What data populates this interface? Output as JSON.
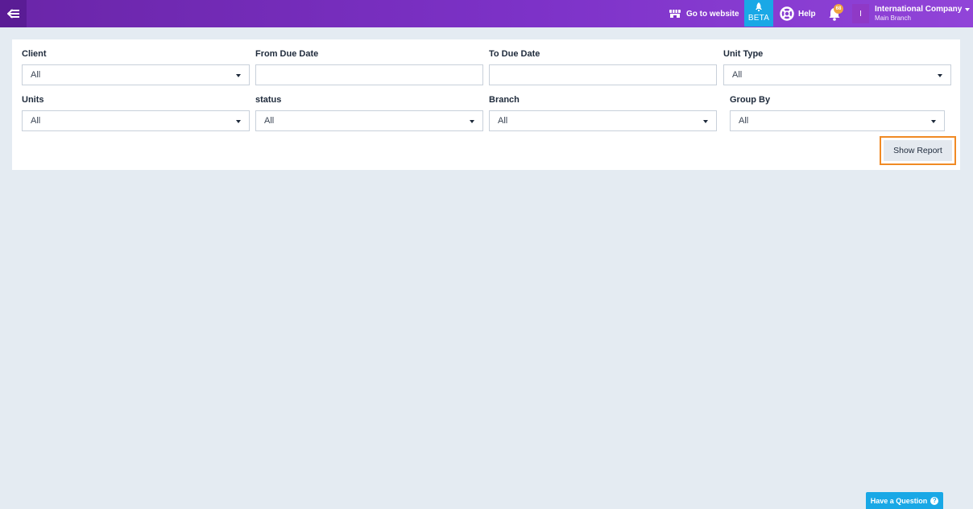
{
  "topbar": {
    "website_label": "Go to website",
    "beta_label": "BETA",
    "help_label": "Help",
    "notification_count": "68",
    "avatar_initial": "I",
    "company_name": "International Company",
    "branch_name": "Main Branch"
  },
  "filters": {
    "client": {
      "label": "Client",
      "value": "All"
    },
    "from_due_date": {
      "label": "From Due Date",
      "value": ""
    },
    "to_due_date": {
      "label": "To Due Date",
      "value": ""
    },
    "unit_type": {
      "label": "Unit Type",
      "value": "All"
    },
    "units": {
      "label": "Units",
      "value": "All"
    },
    "status": {
      "label": "status",
      "value": "All"
    },
    "branch": {
      "label": "Branch",
      "value": "All"
    },
    "group_by": {
      "label": "Group By",
      "value": "All"
    }
  },
  "actions": {
    "show_report": "Show Report",
    "have_question": "Have a Question"
  },
  "colors": {
    "topbar_start": "#6a25a8",
    "topbar_end": "#9144d8",
    "accent_blue": "#19a8e6",
    "highlight_orange": "#f08a24",
    "badge": "#f0a340"
  }
}
